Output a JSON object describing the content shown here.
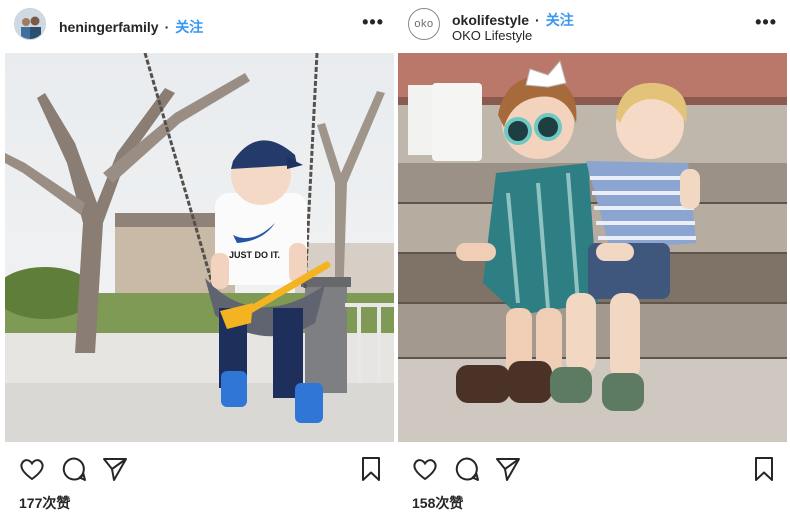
{
  "posts": [
    {
      "username": "heningerfamily",
      "follow_label": "关注",
      "subtitle": "",
      "likes": "177次赞",
      "photo_icon": "child-on-swing-photo",
      "avatar_icon": "family-avatar"
    },
    {
      "username": "okolifestyle",
      "follow_label": "关注",
      "subtitle": "OKO Lifestyle",
      "avatar_text": "oko",
      "likes": "158次赞",
      "photo_icon": "two-kids-on-steps-photo",
      "shirt_text": "JUST DO IT."
    }
  ],
  "shirt_text": "JUST DO IT.",
  "more_label": "•••",
  "colors": {
    "follow": "#3897f0",
    "text": "#262626"
  }
}
